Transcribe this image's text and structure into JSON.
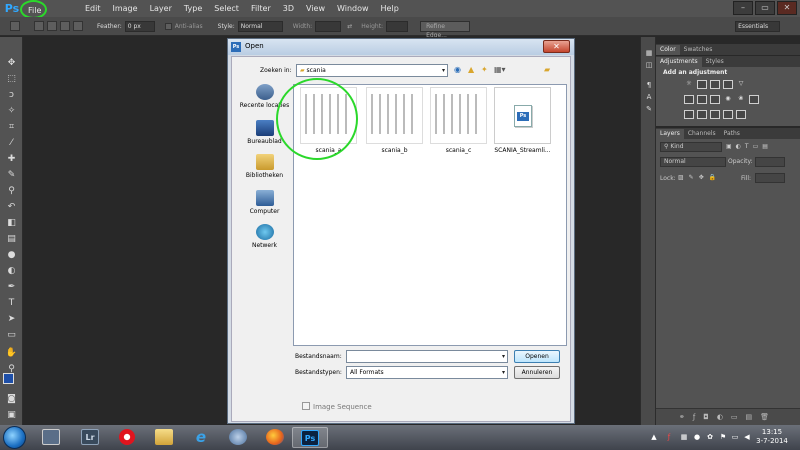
{
  "app": {
    "logo": "Ps"
  },
  "menu": [
    "File",
    "Edit",
    "Image",
    "Layer",
    "Type",
    "Select",
    "Filter",
    "3D",
    "View",
    "Window",
    "Help"
  ],
  "window_controls": {
    "minimize": "–",
    "restore": "▭",
    "close": "✕"
  },
  "options": {
    "feather_label": "Feather:",
    "feather_value": "0 px",
    "antialias_label": "Anti-alias",
    "style_label": "Style:",
    "style_value": "Normal",
    "width_label": "Width:",
    "height_label": "Height:",
    "refine_edge": "Refine Edge...",
    "workspace": "Essentials"
  },
  "panels": {
    "color_tab": "Color",
    "swatches_tab": "Swatches",
    "adjustments_tab": "Adjustments",
    "styles_tab": "Styles",
    "add_adjustment": "Add an adjustment",
    "layers_tab": "Layers",
    "channels_tab": "Channels",
    "paths_tab": "Paths",
    "kind_filter": "Kind",
    "blend_mode": "Normal",
    "opacity_label": "Opacity:",
    "lock_label": "Lock:",
    "fill_label": "Fill:"
  },
  "dialog": {
    "title": "Open",
    "close": "✕",
    "look_in_label": "Zoeken in:",
    "look_in_value": "scania",
    "places": [
      {
        "label": "Recente locaties"
      },
      {
        "label": "Bureaublad"
      },
      {
        "label": "Bibliotheken"
      },
      {
        "label": "Computer"
      },
      {
        "label": "Netwerk"
      }
    ],
    "files": [
      {
        "name": "scania_a"
      },
      {
        "name": "scania_b"
      },
      {
        "name": "scania_c"
      },
      {
        "name": "SCANIA_Streamli..."
      }
    ],
    "filename_label": "Bestandsnaam:",
    "filename_value": "",
    "filetype_label": "Bestandstypen:",
    "filetype_value": "All Formats",
    "open_button": "Openen",
    "cancel_button": "Annuleren",
    "image_sequence": "Image Sequence"
  },
  "taskbar": {
    "clock_time": "13:15",
    "clock_date": "3-7-2014",
    "apps": [
      "Lr",
      "Ps"
    ]
  }
}
